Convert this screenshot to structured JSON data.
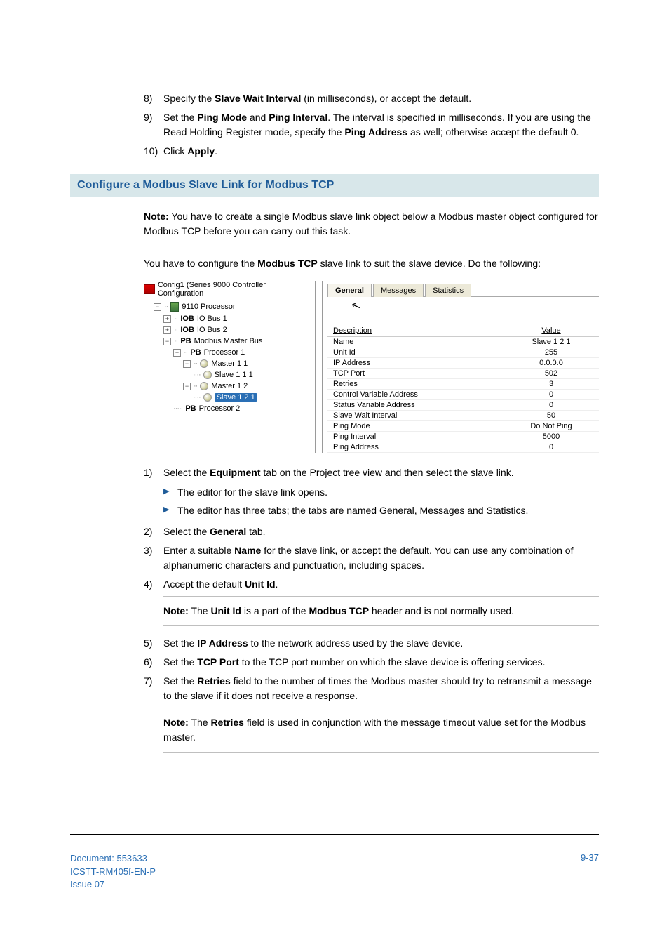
{
  "steps_top": [
    {
      "num": "8)",
      "pre": "Specify the ",
      "b1": "Slave Wait Interval",
      "post": " (in milliseconds), or accept the default."
    },
    {
      "num": "9)",
      "pre": "Set the ",
      "b1": "Ping Mode",
      "mid1": " and ",
      "b2": "Ping Interval",
      "mid2": ". The interval is specified in milliseconds. If you are using the Read Holding Register mode, specify the ",
      "b3": "Ping Address",
      "post": " as well; otherwise accept the default 0."
    },
    {
      "num": "10)",
      "pre": "Click ",
      "b1": "Apply",
      "post": "."
    }
  ],
  "section_title": "Configure a Modbus Slave Link for Modbus TCP",
  "note_intro_bold": "Note:",
  "note_intro_rest": " You have to create a single Modbus slave link object below a Modbus master object configured for Modbus TCP before you can carry out this task.",
  "lead_para_pre": "You have to configure the ",
  "lead_para_bold": "Modbus TCP",
  "lead_para_post": " slave link to suit the slave device. Do the following:",
  "tree": {
    "title": "Config1 (Series 9000 Controller Configuration",
    "proc": "9110 Processor",
    "iob1_b": "IOB",
    "iob1_rest": "IO Bus 1",
    "iob2_b": "IOB",
    "iob2_rest": "IO Bus 2",
    "pb_mb_b": "PB",
    "pb_mb_rest": "Modbus Master Bus",
    "pb_p1_b": "PB",
    "pb_p1_rest": "Processor 1",
    "m11": "Master 1 1",
    "s111": "Slave 1 1 1",
    "m12": "Master 1 2",
    "s121": "Slave 1 2 1",
    "pb_p2_b": "PB",
    "pb_p2_rest": "Processor 2"
  },
  "tabs": {
    "general": "General",
    "messages": "Messages",
    "statistics": "Statistics"
  },
  "prop_headers": {
    "desc": "Description",
    "value": "Value"
  },
  "props": [
    {
      "desc": "Name",
      "value": "Slave 1 2 1"
    },
    {
      "desc": "Unit Id",
      "value": "255"
    },
    {
      "desc": "IP Address",
      "value": "0.0.0.0"
    },
    {
      "desc": "TCP Port",
      "value": "502"
    },
    {
      "desc": "Retries",
      "value": "3"
    },
    {
      "desc": "Control Variable Address",
      "value": "0"
    },
    {
      "desc": "Status Variable Address",
      "value": "0"
    },
    {
      "desc": "Slave Wait Interval",
      "value": "50"
    },
    {
      "desc": "Ping Mode",
      "value": "Do Not Ping"
    },
    {
      "desc": "Ping Interval",
      "value": "5000"
    },
    {
      "desc": "Ping Address",
      "value": "0"
    }
  ],
  "steps_mid": {
    "s1": {
      "num": "1)",
      "pre": "Select the ",
      "b1": "Equipment",
      "post": " tab on the Project tree view and then select the slave link."
    },
    "s1_bullets": [
      "The editor for the slave link opens.",
      "The editor has three tabs; the tabs are named General, Messages and Statistics."
    ],
    "s2": {
      "num": "2)",
      "pre": "Select the ",
      "b1": "General",
      "post": " tab."
    },
    "s3": {
      "num": "3)",
      "pre": "Enter a suitable ",
      "b1": "Name",
      "post": " for the slave link, or accept the default. You can use any combination of alphanumeric characters and punctuation, including spaces."
    },
    "s4": {
      "num": "4)",
      "pre": "Accept the default ",
      "b1": "Unit Id",
      "post": "."
    }
  },
  "note_unit_bold": "Note:",
  "note_unit_mid1": " The ",
  "note_unit_b1": "Unit Id",
  "note_unit_mid2": " is a part of the ",
  "note_unit_b2": "Modbus TCP",
  "note_unit_post": " header and is not normally used.",
  "steps_after": {
    "s5": {
      "num": "5)",
      "pre": "Set the ",
      "b1": "IP Address",
      "post": " to the network address used by the slave device."
    },
    "s6": {
      "num": "6)",
      "pre": "Set the ",
      "b1": "TCP Port",
      "post": " to the TCP port number on which the slave device is offering services."
    },
    "s7": {
      "num": "7)",
      "pre": "Set the ",
      "b1": "Retries",
      "post": " field to the number of times the Modbus master should try to retransmit a message to the slave if it does not receive a response."
    }
  },
  "note_retries_bold": "Note:",
  "note_retries_mid1": " The ",
  "note_retries_b1": "Retries",
  "note_retries_post": " field is used in conjunction with the message timeout value set for the Modbus master.",
  "footer": {
    "doc": "Document: 553633",
    "code": "ICSTT-RM405f-EN-P",
    "issue": "Issue 07",
    "page": "9-37"
  }
}
